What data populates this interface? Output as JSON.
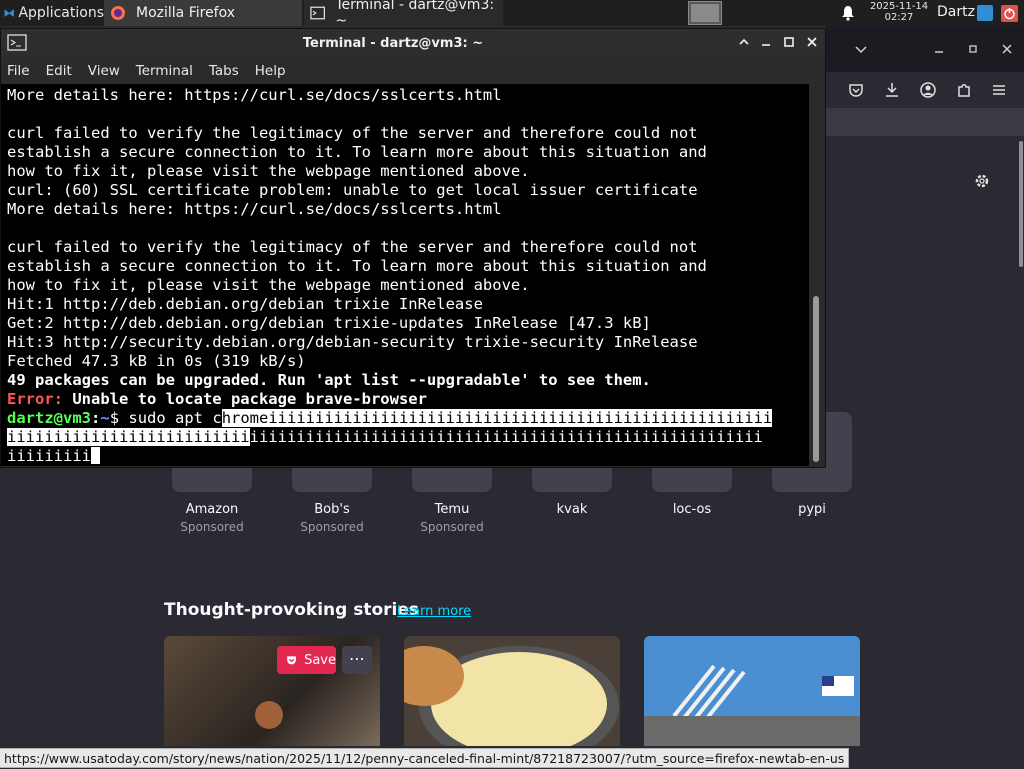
{
  "panel": {
    "applications_label": "Applications",
    "tasks": [
      {
        "label": "Mozilla Firefox"
      },
      {
        "label": "Terminal - dartz@vm3: ~"
      }
    ],
    "clock_date": "2025-11-14",
    "clock_time": "02:27",
    "user": "Dartz"
  },
  "terminal": {
    "title": "Terminal - dartz@vm3: ~",
    "menu": [
      "File",
      "Edit",
      "View",
      "Terminal",
      "Tabs",
      "Help"
    ],
    "lines": [
      "More details here: https://curl.se/docs/sslcerts.html",
      "",
      "curl failed to verify the legitimacy of the server and therefore could not",
      "establish a secure connection to it. To learn more about this situation and",
      "how to fix it, please visit the webpage mentioned above.",
      "curl: (60) SSL certificate problem: unable to get local issuer certificate",
      "More details here: https://curl.se/docs/sslcerts.html",
      "",
      "curl failed to verify the legitimacy of the server and therefore could not",
      "establish a secure connection to it. To learn more about this situation and",
      "how to fix it, please visit the webpage mentioned above.",
      "Hit:1 http://deb.debian.org/debian trixie InRelease",
      "Get:2 http://deb.debian.org/debian trixie-updates InRelease [47.3 kB]",
      "Hit:3 http://security.debian.org/debian-security trixie-security InRelease",
      "Fetched 47.3 kB in 0s (319 kB/s)"
    ],
    "upgrade_line": "49 packages can be upgraded. Run 'apt list --upgradable' to see them.",
    "error_prefix": "Error:",
    "error_text": " Unable to locate package brave-browser",
    "prompt_user": "dartz@vm3",
    "prompt_sep": ":",
    "prompt_path": "~",
    "prompt_sign": "$ ",
    "command_plain": "sudo apt c",
    "command_selected": "hromeiiiiiiiiiiiiiiiiiiiiiiiiiiiiiiiiiiiiiiiiiiiiiiiiiiiiii",
    "wrap2_selected": "iiiiiiiiiiiiiiiiiiiiiiiiii",
    "wrap2_plain": "iiiiiiiiiiiiiiiiiiiiiiiiiiiiiiiiiiiiiiiiiiiiiiiiiiiiiii",
    "wrap3_plain": "iiiiiiiii"
  },
  "firefox": {
    "shortcuts": [
      {
        "label": "Amazon",
        "sub": "Sponsored"
      },
      {
        "label": "Bob's",
        "sub": "Sponsored"
      },
      {
        "label": "Temu",
        "sub": "Sponsored"
      },
      {
        "label": "kvak",
        "sub": ""
      },
      {
        "label": "loc-os",
        "sub": ""
      },
      {
        "label": "pypi",
        "sub": ""
      }
    ],
    "stories_title": "Thought-provoking stories",
    "learn_more": "Learn more",
    "save_label": "Save",
    "more_label": "⋯",
    "status_url": "https://www.usatoday.com/story/news/nation/2025/11/12/penny-canceled-final-mint/87218723007/?utm_source=firefox-newtab-en-us"
  },
  "colors": {
    "prompt_user": "#55ff55",
    "prompt_path": "#6699ff",
    "error": "#ff5555",
    "pocket_save": "#e22850"
  }
}
